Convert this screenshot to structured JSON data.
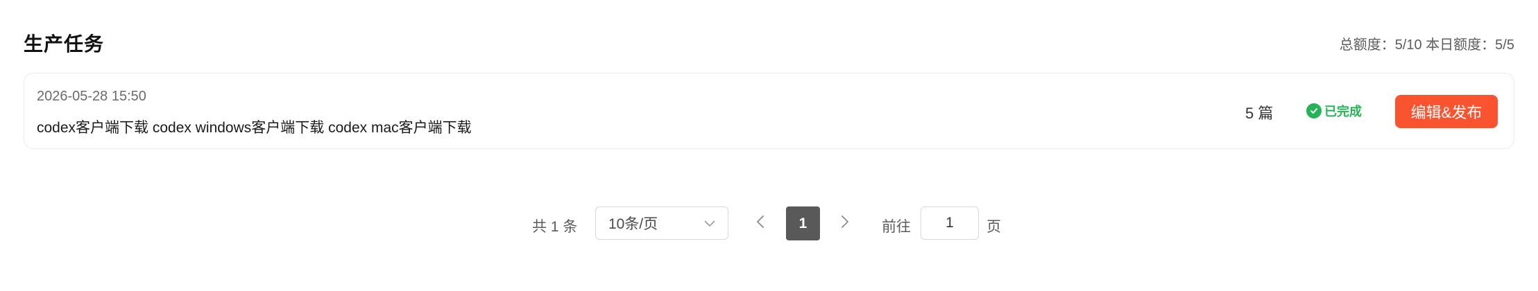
{
  "header": {
    "title": "生产任务",
    "quota": "总额度：5/10 本日额度：5/5"
  },
  "tasks": [
    {
      "date": "2026-05-28 15:50",
      "keywords": "codex客户端下载 codex windows客户端下载 codex mac客户端下载",
      "count": "5 篇",
      "status": "已完成",
      "action_label": "编辑&发布"
    }
  ],
  "pagination": {
    "total_text": "共 1 条",
    "page_size": "10条/页",
    "current_page": "1",
    "goto_label": "前往",
    "goto_value": "1",
    "page_unit": "页"
  },
  "colors": {
    "accent": "#f9532f",
    "success": "#25b357",
    "active_page": "#595959"
  },
  "icons": {
    "status": "check-circle-icon",
    "select": "chevron-down-icon",
    "prev": "chevron-left-icon",
    "next": "chevron-right-icon"
  }
}
